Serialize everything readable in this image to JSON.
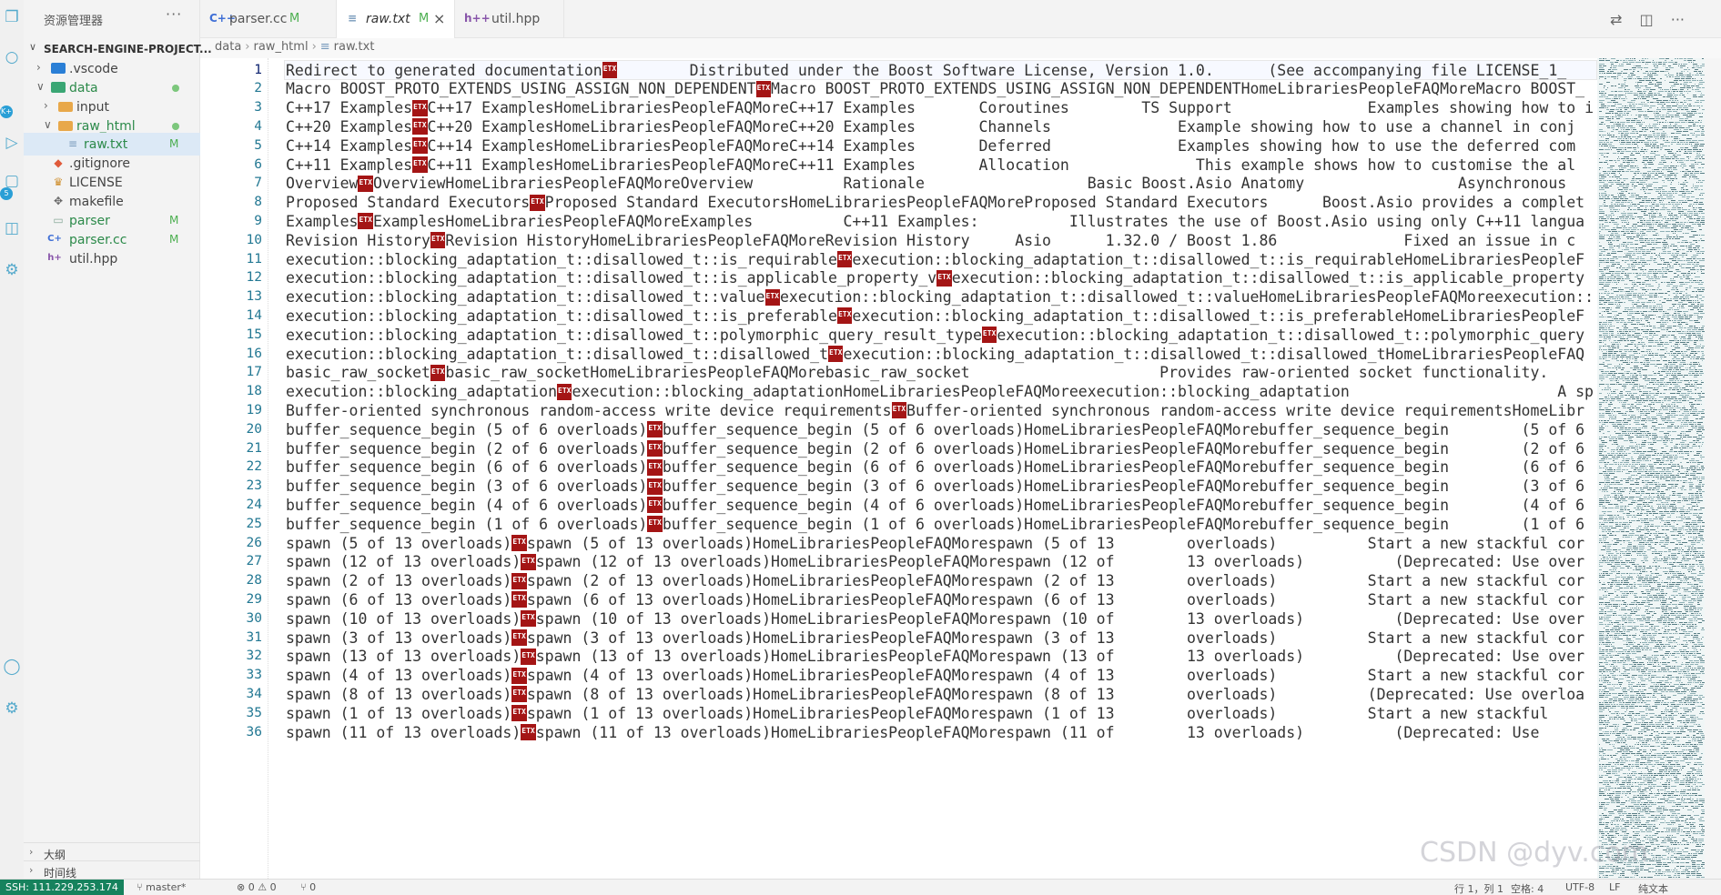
{
  "sidebar": {
    "title": "资源管理器",
    "more": "···",
    "project": "SEARCH-ENGINE-PROJECT...",
    "items": [
      {
        "label": ".vscode",
        "badge": ""
      },
      {
        "label": "data",
        "badge": ""
      },
      {
        "label": "input",
        "badge": ""
      },
      {
        "label": "raw_html",
        "badge": ""
      },
      {
        "label": "raw.txt",
        "badge": "M"
      },
      {
        "label": ".gitignore",
        "badge": ""
      },
      {
        "label": "LICENSE",
        "badge": ""
      },
      {
        "label": "makefile",
        "badge": ""
      },
      {
        "label": "parser",
        "badge": "M"
      },
      {
        "label": "parser.cc",
        "badge": "M"
      },
      {
        "label": "util.hpp",
        "badge": ""
      }
    ],
    "outline": "大纲",
    "timeline": "时间线"
  },
  "tabs": [
    {
      "icon": "C++",
      "label": "parser.cc",
      "mod": "M"
    },
    {
      "icon": "≡",
      "label": "raw.txt",
      "mod": "M",
      "close": "×"
    },
    {
      "icon": "h++",
      "label": "util.hpp",
      "mod": ""
    }
  ],
  "breadcrumb": [
    "data",
    "raw_html",
    "raw.txt"
  ],
  "editor": {
    "etx_label": "ETX",
    "line_numbers": [
      "1",
      "2",
      "3",
      "4",
      "5",
      "6",
      "7",
      "8",
      "9",
      "10",
      "11",
      "12",
      "13",
      "14",
      "15",
      "16",
      "17",
      "18",
      "19",
      "20",
      "21",
      "22",
      "23",
      "24",
      "25",
      "26",
      "27",
      "28",
      "29",
      "30",
      "31",
      "32",
      "33",
      "34",
      "35",
      "36"
    ],
    "lines": [
      [
        "Redirect to generated documentation",
        "        Distributed under the Boost Software License, Version 1.0.      (See accompanying file LICENSE_1_"
      ],
      [
        "Macro BOOST_PROTO_EXTENDS_USING_ASSIGN_NON_DEPENDENT",
        "Macro BOOST_PROTO_EXTENDS_USING_ASSIGN_NON_DEPENDENTHomeLibrariesPeopleFAQMoreMacro BOOST_"
      ],
      [
        "C++17 Examples",
        "C++17 ExamplesHomeLibrariesPeopleFAQMoreC++17 Examples       Coroutines        TS Support               Examples showing how to i"
      ],
      [
        "C++20 Examples",
        "C++20 ExamplesHomeLibrariesPeopleFAQMoreC++20 Examples       Channels              Example showing how to use a channel in conj"
      ],
      [
        "C++14 Examples",
        "C++14 ExamplesHomeLibrariesPeopleFAQMoreC++14 Examples       Deferred              Examples showing how to use the deferred com"
      ],
      [
        "C++11 Examples",
        "C++11 ExamplesHomeLibrariesPeopleFAQMoreC++11 Examples       Allocation              This example shows how to customise the al"
      ],
      [
        "Overview",
        "OverviewHomeLibrariesPeopleFAQMoreOverview          Rationale                  Basic Boost.Asio Anatomy                 Asynchronous"
      ],
      [
        "Proposed Standard Executors",
        "Proposed Standard ExecutorsHomeLibrariesPeopleFAQMoreProposed Standard Executors      Boost.Asio provides a complet"
      ],
      [
        "Examples",
        "ExamplesHomeLibrariesPeopleFAQMoreExamples          C++11 Examples:          Illustrates the use of Boost.Asio using only C++11 langua"
      ],
      [
        "Revision History",
        "Revision HistoryHomeLibrariesPeopleFAQMoreRevision History     Asio      1.32.0 / Boost 1.86              Fixed an issue in c"
      ],
      [
        "execution::blocking_adaptation_t::disallowed_t::is_requirable",
        "execution::blocking_adaptation_t::disallowed_t::is_requirableHomeLibrariesPeopleF"
      ],
      [
        "execution::blocking_adaptation_t::disallowed_t::is_applicable_property_v",
        "execution::blocking_adaptation_t::disallowed_t::is_applicable_property"
      ],
      [
        "execution::blocking_adaptation_t::disallowed_t::value",
        "execution::blocking_adaptation_t::disallowed_t::valueHomeLibrariesPeopleFAQMoreexecution::"
      ],
      [
        "execution::blocking_adaptation_t::disallowed_t::is_preferable",
        "execution::blocking_adaptation_t::disallowed_t::is_preferableHomeLibrariesPeopleF"
      ],
      [
        "execution::blocking_adaptation_t::disallowed_t::polymorphic_query_result_type",
        "execution::blocking_adaptation_t::disallowed_t::polymorphic_query"
      ],
      [
        "execution::blocking_adaptation_t::disallowed_t::disallowed_t",
        "execution::blocking_adaptation_t::disallowed_t::disallowed_tHomeLibrariesPeopleFAQ"
      ],
      [
        "basic_raw_socket",
        "basic_raw_socketHomeLibrariesPeopleFAQMorebasic_raw_socket                     Provides raw-oriented socket functionality."
      ],
      [
        "execution::blocking_adaptation",
        "execution::blocking_adaptationHomeLibrariesPeopleFAQMoreexecution::blocking_adaptation                       A sp"
      ],
      [
        "Buffer-oriented synchronous random-access write device requirements",
        "Buffer-oriented synchronous random-access write device requirementsHomeLibr"
      ],
      [
        "buffer_sequence_begin (5 of 6 overloads)",
        "buffer_sequence_begin (5 of 6 overloads)HomeLibrariesPeopleFAQMorebuffer_sequence_begin        (5 of 6"
      ],
      [
        "buffer_sequence_begin (2 of 6 overloads)",
        "buffer_sequence_begin (2 of 6 overloads)HomeLibrariesPeopleFAQMorebuffer_sequence_begin        (2 of 6"
      ],
      [
        "buffer_sequence_begin (6 of 6 overloads)",
        "buffer_sequence_begin (6 of 6 overloads)HomeLibrariesPeopleFAQMorebuffer_sequence_begin        (6 of 6"
      ],
      [
        "buffer_sequence_begin (3 of 6 overloads)",
        "buffer_sequence_begin (3 of 6 overloads)HomeLibrariesPeopleFAQMorebuffer_sequence_begin        (3 of 6"
      ],
      [
        "buffer_sequence_begin (4 of 6 overloads)",
        "buffer_sequence_begin (4 of 6 overloads)HomeLibrariesPeopleFAQMorebuffer_sequence_begin        (4 of 6"
      ],
      [
        "buffer_sequence_begin (1 of 6 overloads)",
        "buffer_sequence_begin (1 of 6 overloads)HomeLibrariesPeopleFAQMorebuffer_sequence_begin        (1 of 6"
      ],
      [
        "spawn (5 of 13 overloads)",
        "spawn (5 of 13 overloads)HomeLibrariesPeopleFAQMorespawn (5 of 13        overloads)          Start a new stackful cor"
      ],
      [
        "spawn (12 of 13 overloads)",
        "spawn (12 of 13 overloads)HomeLibrariesPeopleFAQMorespawn (12 of        13 overloads)          (Deprecated: Use over"
      ],
      [
        "spawn (2 of 13 overloads)",
        "spawn (2 of 13 overloads)HomeLibrariesPeopleFAQMorespawn (2 of 13        overloads)          Start a new stackful cor"
      ],
      [
        "spawn (6 of 13 overloads)",
        "spawn (6 of 13 overloads)HomeLibrariesPeopleFAQMorespawn (6 of 13        overloads)          Start a new stackful cor"
      ],
      [
        "spawn (10 of 13 overloads)",
        "spawn (10 of 13 overloads)HomeLibrariesPeopleFAQMorespawn (10 of        13 overloads)          (Deprecated: Use over"
      ],
      [
        "spawn (3 of 13 overloads)",
        "spawn (3 of 13 overloads)HomeLibrariesPeopleFAQMorespawn (3 of 13        overloads)          Start a new stackful cor"
      ],
      [
        "spawn (13 of 13 overloads)",
        "spawn (13 of 13 overloads)HomeLibrariesPeopleFAQMorespawn (13 of        13 overloads)          (Deprecated: Use over"
      ],
      [
        "spawn (4 of 13 overloads)",
        "spawn (4 of 13 overloads)HomeLibrariesPeopleFAQMorespawn (4 of 13        overloads)          Start a new stackful cor"
      ],
      [
        "spawn (8 of 13 overloads)",
        "spawn (8 of 13 overloads)HomeLibrariesPeopleFAQMorespawn (8 of 13        overloads)          (Deprecated: Use overloa"
      ],
      [
        "spawn (1 of 13 overloads)",
        "spawn (1 of 13 overloads)HomeLibrariesPeopleFAQMorespawn (1 of 13        overloads)          Start a new stackful"
      ],
      [
        "spawn (11 of 13 overloads)",
        "spawn (11 of 13 overloads)HomeLibrariesPeopleFAQMorespawn (11 of        13 overloads)          (Deprecated: Use"
      ]
    ]
  },
  "statusbar": {
    "ssh": "SSH: 111.229.253.174",
    "branch": "master*",
    "problems": "⊗ 0 ⚠ 0",
    "ports": "⑂ 0",
    "position": "行 1，列 1",
    "spaces": "空格: 4",
    "encoding": "UTF-8",
    "eol": "LF",
    "language": "纯文本"
  },
  "watermark": "CSDN @dyv.com",
  "colors": {
    "accent": "#16825d",
    "etx": "#a41515",
    "line_number": "#237893",
    "modified": "#4caf50"
  }
}
